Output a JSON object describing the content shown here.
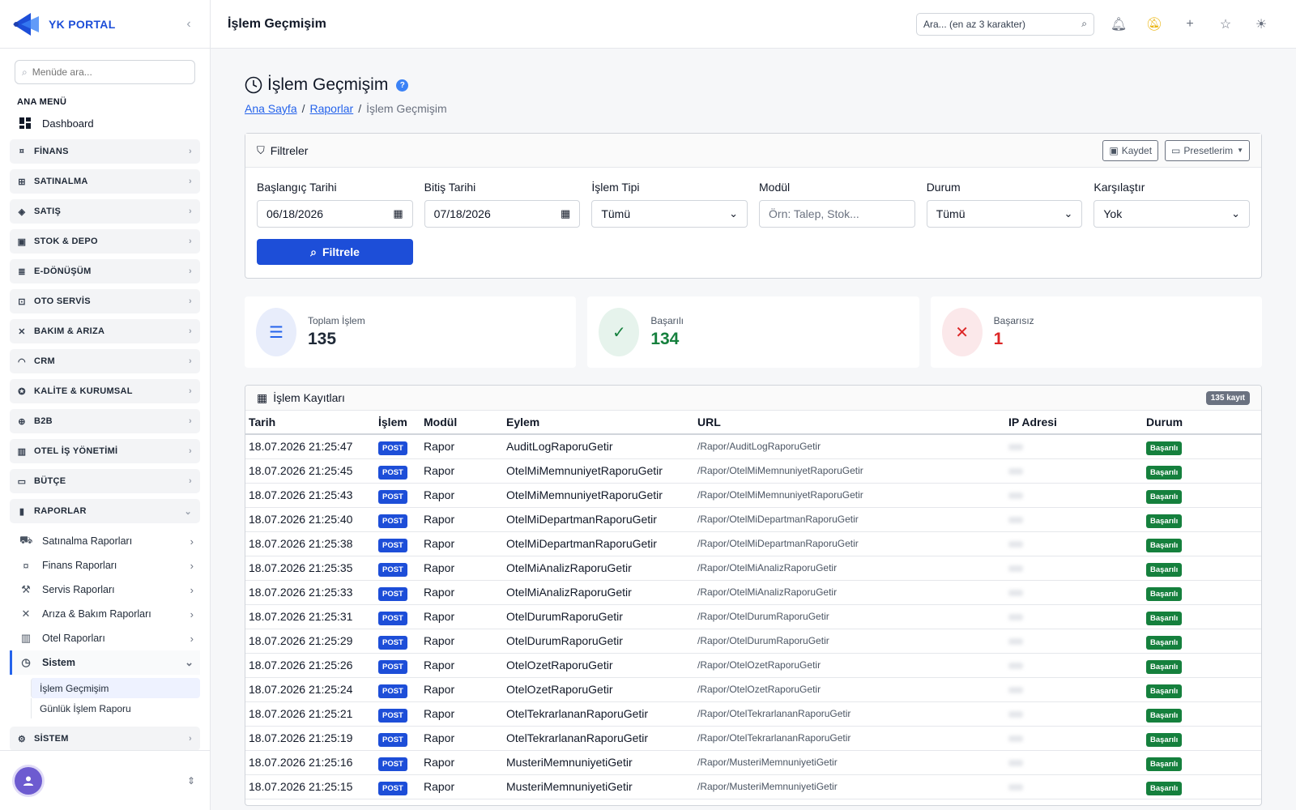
{
  "app": {
    "logo_text": "YK PORTAL"
  },
  "sidebar": {
    "search_placeholder": "Menüde ara...",
    "section_title": "ANA MENÜ",
    "dashboard": "Dashboard",
    "groups": [
      {
        "label": "FİNANS",
        "icon": "finance-icon"
      },
      {
        "label": "SATINALMA",
        "icon": "purchase-icon"
      },
      {
        "label": "SATIŞ",
        "icon": "tag-icon"
      },
      {
        "label": "STOK & DEPO",
        "icon": "box-icon"
      },
      {
        "label": "E-DÖNÜŞÜM",
        "icon": "receipt-icon"
      },
      {
        "label": "OTO SERVİS",
        "icon": "car-icon"
      },
      {
        "label": "BAKIM & ARIZA",
        "icon": "tools-icon"
      },
      {
        "label": "CRM",
        "icon": "headset-icon"
      },
      {
        "label": "KALİTE & KURUMSAL",
        "icon": "badge-icon"
      },
      {
        "label": "B2B",
        "icon": "globe-icon"
      },
      {
        "label": "OTEL İŞ YÖNETİMİ",
        "icon": "building-icon"
      },
      {
        "label": "BÜTÇE",
        "icon": "wallet-icon"
      }
    ],
    "reports_group": "RAPORLAR",
    "report_items": [
      {
        "label": "Satınalma Raporları",
        "icon": "cart-icon"
      },
      {
        "label": "Finans Raporları",
        "icon": "finance-icon"
      },
      {
        "label": "Servis Raporları",
        "icon": "wrench-icon"
      },
      {
        "label": "Arıza & Bakım Raporları",
        "icon": "tools-icon"
      },
      {
        "label": "Otel Raporları",
        "icon": "building-icon"
      }
    ],
    "sistem_item": "Sistem",
    "sistem_children": [
      "İşlem Geçmişim",
      "Günlük İşlem Raporu"
    ],
    "bottom_group": "SİSTEM"
  },
  "topbar": {
    "title": "İşlem Geçmişim",
    "search_placeholder": "Ara... (en az 3 karakter)"
  },
  "page": {
    "title": "İşlem Geçmişim",
    "breadcrumb": [
      "Ana Sayfa",
      "Raporlar",
      "İşlem Geçmişim"
    ]
  },
  "filters": {
    "title": "Filtreler",
    "save_label": "Kaydet",
    "presets_label": "Presetlerim",
    "fields": {
      "start_label": "Başlangıç Tarihi",
      "start_value": "06/18/2026",
      "end_label": "Bitiş Tarihi",
      "end_value": "07/18/2026",
      "type_label": "İşlem Tipi",
      "type_value": "Tümü",
      "module_label": "Modül",
      "module_placeholder": "Örn: Talep, Stok...",
      "status_label": "Durum",
      "status_value": "Tümü",
      "compare_label": "Karşılaştır",
      "compare_value": "Yok"
    },
    "button": "Filtrele"
  },
  "stats": {
    "total_label": "Toplam İşlem",
    "total_value": "135",
    "success_label": "Başarılı",
    "success_value": "134",
    "fail_label": "Başarısız",
    "fail_value": "1"
  },
  "table": {
    "title": "İşlem Kayıtları",
    "count_badge": "135 kayıt",
    "headers": [
      "Tarih",
      "İşlem",
      "Modül",
      "Eylem",
      "URL",
      "IP Adresi",
      "Durum"
    ],
    "rows": [
      {
        "date": "18.07.2026 21:25:47",
        "method": "POST",
        "module": "Rapor",
        "action": "AuditLogRaporuGetir",
        "url": "/Rapor/AuditLogRaporuGetir",
        "status": "Başarılı"
      },
      {
        "date": "18.07.2026 21:25:45",
        "method": "POST",
        "module": "Rapor",
        "action": "OtelMiMemnuniyetRaporuGetir",
        "url": "/Rapor/OtelMiMemnuniyetRaporuGetir",
        "status": "Başarılı"
      },
      {
        "date": "18.07.2026 21:25:43",
        "method": "POST",
        "module": "Rapor",
        "action": "OtelMiMemnuniyetRaporuGetir",
        "url": "/Rapor/OtelMiMemnuniyetRaporuGetir",
        "status": "Başarılı"
      },
      {
        "date": "18.07.2026 21:25:40",
        "method": "POST",
        "module": "Rapor",
        "action": "OtelMiDepartmanRaporuGetir",
        "url": "/Rapor/OtelMiDepartmanRaporuGetir",
        "status": "Başarılı"
      },
      {
        "date": "18.07.2026 21:25:38",
        "method": "POST",
        "module": "Rapor",
        "action": "OtelMiDepartmanRaporuGetir",
        "url": "/Rapor/OtelMiDepartmanRaporuGetir",
        "status": "Başarılı"
      },
      {
        "date": "18.07.2026 21:25:35",
        "method": "POST",
        "module": "Rapor",
        "action": "OtelMiAnalizRaporuGetir",
        "url": "/Rapor/OtelMiAnalizRaporuGetir",
        "status": "Başarılı"
      },
      {
        "date": "18.07.2026 21:25:33",
        "method": "POST",
        "module": "Rapor",
        "action": "OtelMiAnalizRaporuGetir",
        "url": "/Rapor/OtelMiAnalizRaporuGetir",
        "status": "Başarılı"
      },
      {
        "date": "18.07.2026 21:25:31",
        "method": "POST",
        "module": "Rapor",
        "action": "OtelDurumRaporuGetir",
        "url": "/Rapor/OtelDurumRaporuGetir",
        "status": "Başarılı"
      },
      {
        "date": "18.07.2026 21:25:29",
        "method": "POST",
        "module": "Rapor",
        "action": "OtelDurumRaporuGetir",
        "url": "/Rapor/OtelDurumRaporuGetir",
        "status": "Başarılı"
      },
      {
        "date": "18.07.2026 21:25:26",
        "method": "POST",
        "module": "Rapor",
        "action": "OtelOzetRaporuGetir",
        "url": "/Rapor/OtelOzetRaporuGetir",
        "status": "Başarılı"
      },
      {
        "date": "18.07.2026 21:25:24",
        "method": "POST",
        "module": "Rapor",
        "action": "OtelOzetRaporuGetir",
        "url": "/Rapor/OtelOzetRaporuGetir",
        "status": "Başarılı"
      },
      {
        "date": "18.07.2026 21:25:21",
        "method": "POST",
        "module": "Rapor",
        "action": "OtelTekrarlananRaporuGetir",
        "url": "/Rapor/OtelTekrarlananRaporuGetir",
        "status": "Başarılı"
      },
      {
        "date": "18.07.2026 21:25:19",
        "method": "POST",
        "module": "Rapor",
        "action": "OtelTekrarlananRaporuGetir",
        "url": "/Rapor/OtelTekrarlananRaporuGetir",
        "status": "Başarılı"
      },
      {
        "date": "18.07.2026 21:25:16",
        "method": "POST",
        "module": "Rapor",
        "action": "MusteriMemnuniyetiGetir",
        "url": "/Rapor/MusteriMemnuniyetiGetir",
        "status": "Başarılı"
      },
      {
        "date": "18.07.2026 21:25:15",
        "method": "POST",
        "module": "Rapor",
        "action": "MusteriMemnuniyetiGetir",
        "url": "/Rapor/MusteriMemnuniyetiGetir",
        "status": "Başarılı"
      }
    ]
  },
  "colors": {
    "accent": "#1d4ed8",
    "success": "#15803d",
    "danger": "#dc2626"
  }
}
